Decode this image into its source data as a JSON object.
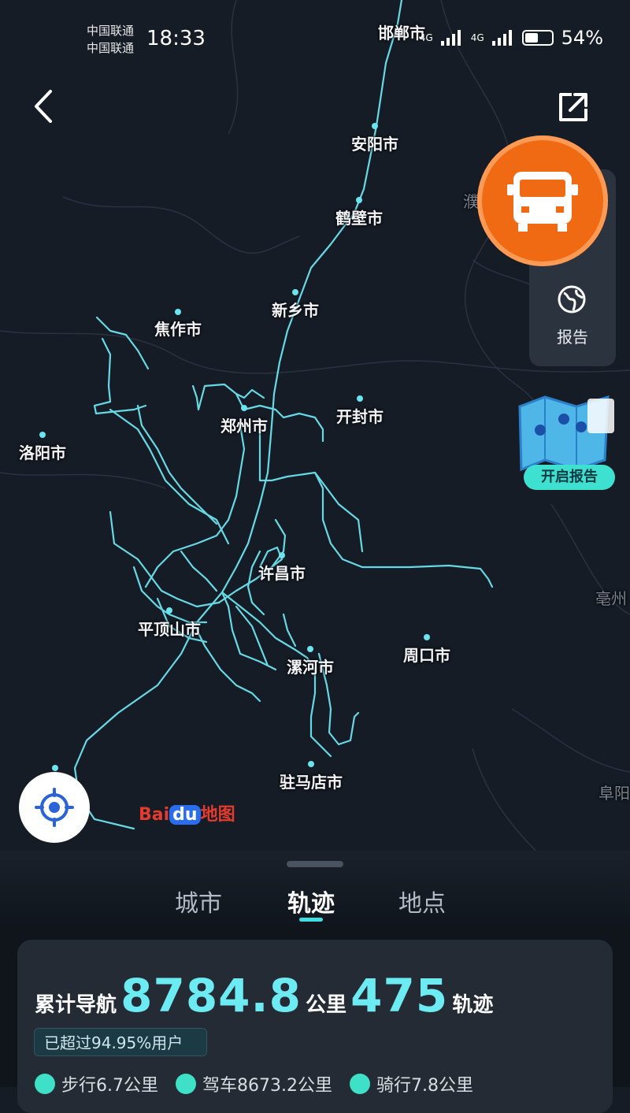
{
  "status_bar": {
    "carrier_1": "中国联通",
    "carrier_2": "中国联通",
    "time": "18:33",
    "network": "4G",
    "battery": "54%"
  },
  "map": {
    "cities": [
      {
        "label": "邯郸市"
      },
      {
        "label": "安阳市"
      },
      {
        "label": "鹤壁市"
      },
      {
        "label": "新乡市"
      },
      {
        "label": "焦作市"
      },
      {
        "label": "郑州市"
      },
      {
        "label": "开封市"
      },
      {
        "label": "洛阳市"
      },
      {
        "label": "许昌市"
      },
      {
        "label": "平顶山市"
      },
      {
        "label": "漯河市"
      },
      {
        "label": "周口市"
      },
      {
        "label": "驻马店市"
      },
      {
        "label": "亳州"
      },
      {
        "label": "阜阳"
      },
      {
        "label": "濮"
      }
    ],
    "track_color": "#6be4ef",
    "logo_text": "Baidu地图"
  },
  "side": {
    "report_label": "报告",
    "open_report_label": "开启报告"
  },
  "tabs": [
    {
      "label": "城市"
    },
    {
      "label": "轨迹"
    },
    {
      "label": "地点"
    }
  ],
  "summary": {
    "prefix": "累计导航",
    "distance": "8784.8",
    "distance_unit": "公里",
    "tracks": "475",
    "tracks_unit": "轨迹",
    "badge": "已超过94.95%用户"
  },
  "modes": [
    {
      "icon": "walk-icon",
      "label": "步行6.7公里"
    },
    {
      "icon": "car-icon",
      "label": "驾车8673.2公里"
    },
    {
      "icon": "bike-icon",
      "label": "骑行7.8公里"
    }
  ],
  "colors": {
    "accent": "#6cecf2",
    "truck_button": "#f06a14",
    "background": "#151c26"
  }
}
